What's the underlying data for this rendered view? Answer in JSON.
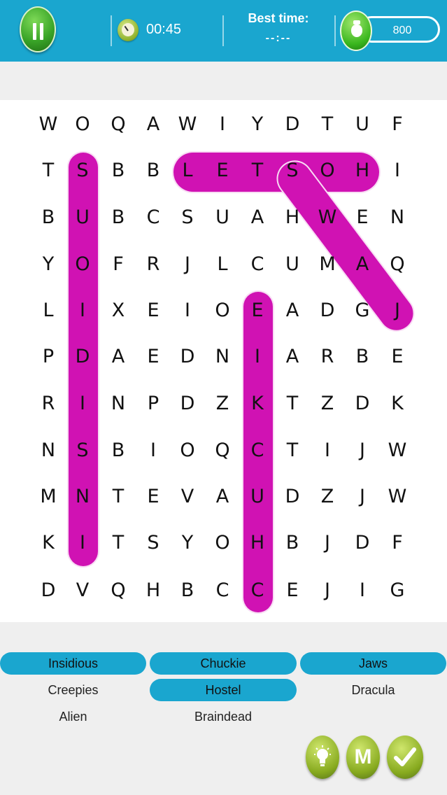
{
  "header": {
    "timer": "00:45",
    "best_time_label": "Best time:",
    "best_time_value": "--:--",
    "coins": "800"
  },
  "grid": [
    [
      "W",
      "O",
      "Q",
      "A",
      "W",
      "I",
      "Y",
      "D",
      "T",
      "U",
      "F"
    ],
    [
      "T",
      "S",
      "B",
      "B",
      "L",
      "E",
      "T",
      "S",
      "O",
      "H",
      "I"
    ],
    [
      "B",
      "U",
      "B",
      "C",
      "S",
      "U",
      "A",
      "H",
      "W",
      "E",
      "N"
    ],
    [
      "Y",
      "O",
      "F",
      "R",
      "J",
      "L",
      "C",
      "U",
      "M",
      "A",
      "Q"
    ],
    [
      "L",
      "I",
      "X",
      "E",
      "I",
      "O",
      "E",
      "A",
      "D",
      "G",
      "J"
    ],
    [
      "P",
      "D",
      "A",
      "E",
      "D",
      "N",
      "I",
      "A",
      "R",
      "B",
      "E"
    ],
    [
      "R",
      "I",
      "N",
      "P",
      "D",
      "Z",
      "K",
      "T",
      "Z",
      "D",
      "K"
    ],
    [
      "N",
      "S",
      "B",
      "I",
      "O",
      "Q",
      "C",
      "T",
      "I",
      "J",
      "W"
    ],
    [
      "M",
      "N",
      "T",
      "E",
      "V",
      "A",
      "U",
      "D",
      "Z",
      "J",
      "W"
    ],
    [
      "K",
      "I",
      "T",
      "S",
      "Y",
      "O",
      "H",
      "B",
      "J",
      "D",
      "F"
    ],
    [
      "D",
      "V",
      "Q",
      "H",
      "B",
      "C",
      "C",
      "E",
      "J",
      "I",
      "G"
    ]
  ],
  "words": [
    {
      "label": "Insidious",
      "found": true
    },
    {
      "label": "Chuckie",
      "found": true
    },
    {
      "label": "Jaws",
      "found": true
    },
    {
      "label": "Creepies",
      "found": false
    },
    {
      "label": "Hostel",
      "found": true
    },
    {
      "label": "Dracula",
      "found": false
    },
    {
      "label": "Alien",
      "found": false
    },
    {
      "label": "Braindead",
      "found": false
    }
  ],
  "buttons": {
    "hint_icon": "lightbulb-icon",
    "middle_label": "M",
    "check_icon": "checkmark-icon"
  },
  "colors": {
    "topbar": "#1aa6cf",
    "highlight": "#d012b3",
    "found_word": "#1aa6cf",
    "button_green": "#87aa1f"
  }
}
